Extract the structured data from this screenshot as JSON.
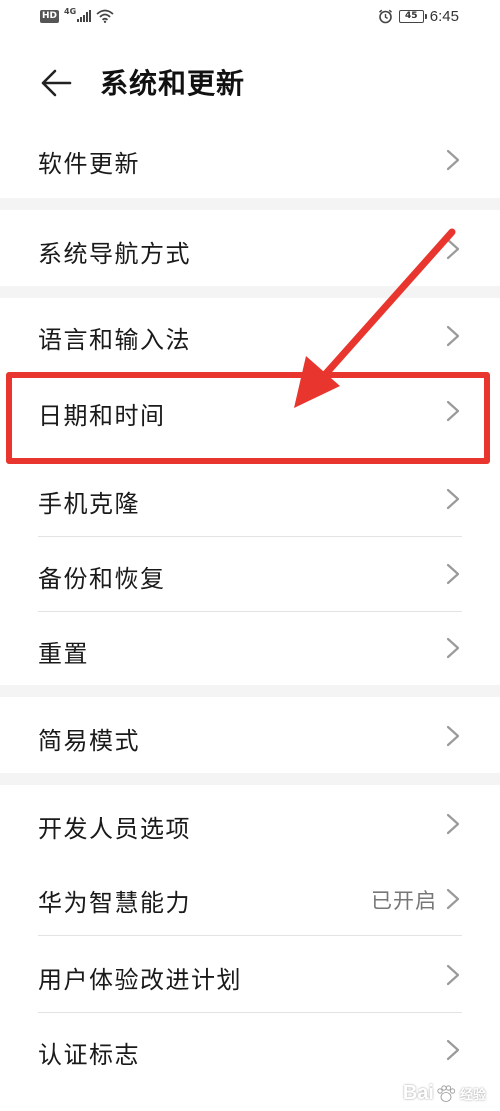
{
  "status_bar": {
    "hd_badge": "HD",
    "network": "4G",
    "battery_level": "45",
    "time": "6:45",
    "icons": [
      "hd-icon",
      "signal-icon",
      "wifi-icon",
      "alarm-icon",
      "battery-icon"
    ]
  },
  "header": {
    "back_icon": "arrow-left-icon",
    "title": "系统和更新"
  },
  "menu": {
    "software_update": "软件更新",
    "system_navigation": "系统导航方式",
    "language_input": "语言和输入法",
    "date_time": "日期和时间",
    "phone_clone": "手机克隆",
    "backup_restore": "备份和恢复",
    "reset": "重置",
    "simple_mode": "简易模式",
    "developer_options": "开发人员选项",
    "huawei_ai": "华为智慧能力",
    "huawei_ai_status": "已开启",
    "user_experience": "用户体验改进计划",
    "certification": "认证标志"
  },
  "annotation": {
    "color": "#e8362f",
    "highlighted_item": "日期和时间"
  },
  "watermark": {
    "text": "Bai",
    "sub": "经验"
  },
  "colors": {
    "section_gap": "#f4f4f4",
    "divider": "#e3e3e3",
    "chevron": "#9a9a9a",
    "text": "#1a1a1a",
    "secondary_text": "#777777"
  }
}
